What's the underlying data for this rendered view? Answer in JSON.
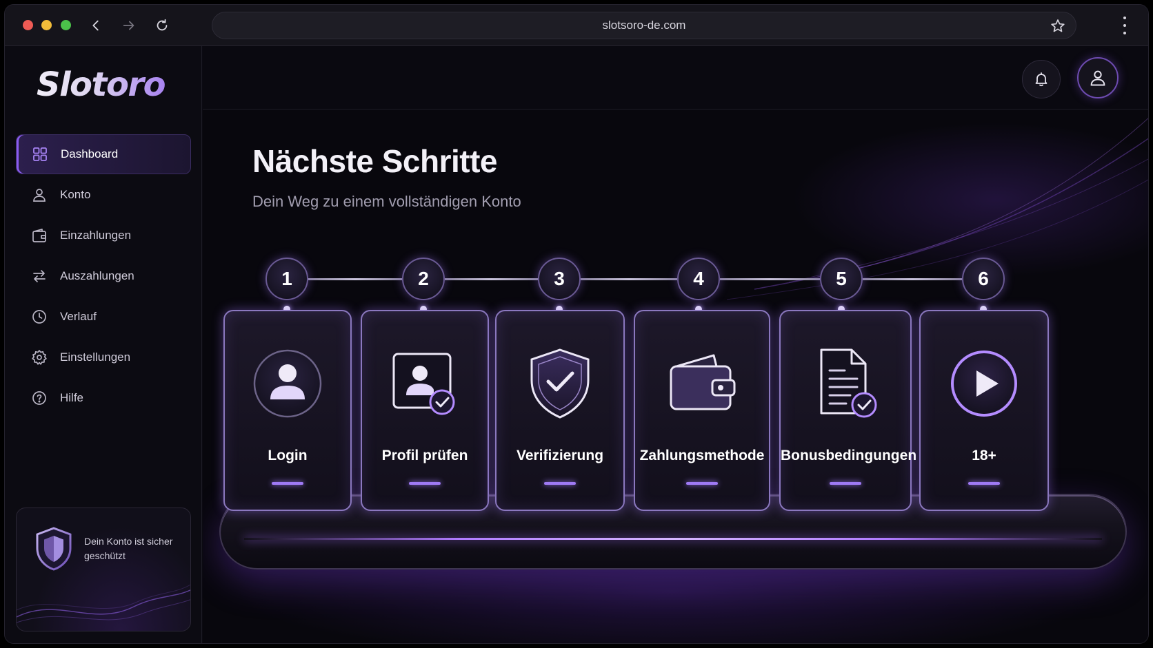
{
  "browser": {
    "url": "slotsoro-de.com",
    "icons": [
      "back-icon",
      "forward-icon",
      "reload-icon",
      "star-icon",
      "kebab-menu-icon"
    ]
  },
  "sidebar": {
    "logo": "Slotoro",
    "items": [
      {
        "label": "Dashboard",
        "icon": "grid-icon",
        "active": true
      },
      {
        "label": "Konto",
        "icon": "user-icon"
      },
      {
        "label": "Einzahlungen",
        "icon": "wallet-icon"
      },
      {
        "label": "Auszahlungen",
        "icon": "transfer-icon"
      },
      {
        "label": "Verlauf",
        "icon": "clock-icon"
      },
      {
        "label": "Einstellungen",
        "icon": "gear-icon"
      },
      {
        "label": "Hilfe",
        "icon": "help-icon"
      }
    ],
    "security_card": {
      "text": "Dein Konto ist sicher geschützt",
      "icon": "shield-icon"
    }
  },
  "topbar": {
    "icons": [
      "bell-icon",
      "user-avatar-icon"
    ]
  },
  "main": {
    "title": "Nächste Schritte",
    "subtitle": "Dein Weg zu einem vollständigen Konto",
    "steps": [
      {
        "number": "1",
        "label": "Login",
        "icon": "user-circle-icon"
      },
      {
        "number": "2",
        "label": "Profil prüfen",
        "icon": "profile-check-icon"
      },
      {
        "number": "3",
        "label": "Verifizierung",
        "icon": "shield-check-icon"
      },
      {
        "number": "4",
        "label": "Zahlungsmethode",
        "icon": "wallet-icon"
      },
      {
        "number": "5",
        "label": "Bonusbedingungen",
        "icon": "document-check-icon"
      },
      {
        "number": "6",
        "label": "18+",
        "icon": "play-icon"
      }
    ]
  },
  "colors": {
    "accent": "#9f7af5",
    "background": "#08070d",
    "card_border": "#8b78bf"
  }
}
